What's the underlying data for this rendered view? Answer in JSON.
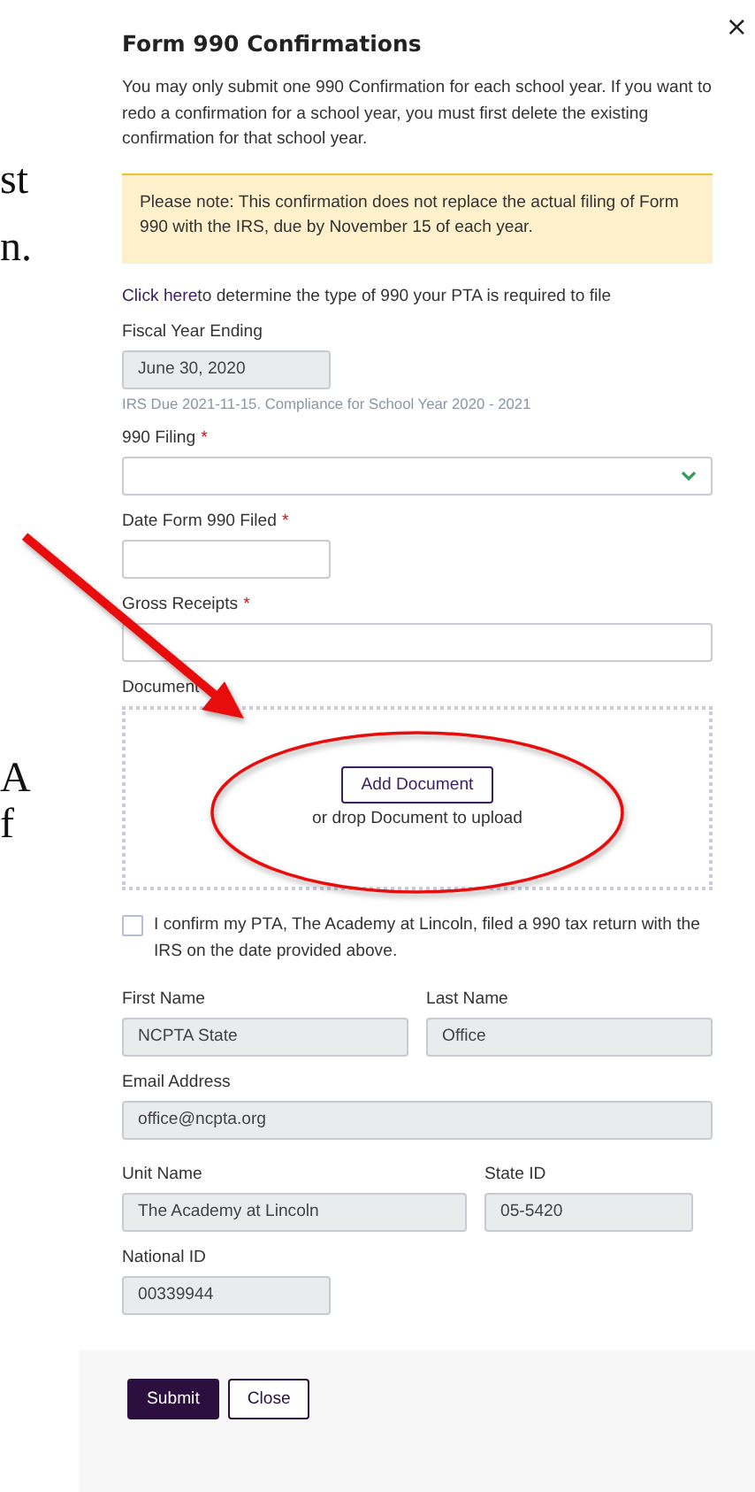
{
  "backdrop_fragments": [
    "st",
    "n.",
    "A",
    "f"
  ],
  "dialog": {
    "title": "Form 990 Confirmations",
    "close": "×"
  },
  "intro": "You may only submit one 990 Confirmation for each school year. If you want to redo a confirmation for a school year, you must first delete the existing confirmation for that school year.",
  "notice": "Please note: This confirmation does not replace the actual filing of Form 990 with the IRS, due by November 15 of each year.",
  "help": {
    "link": "Click here",
    "text": "to determine the type of 990 your PTA is required to file"
  },
  "fiscal_year": {
    "label": "Fiscal Year Ending",
    "value": "June 30, 2020",
    "hint": "IRS Due 2021-11-15. Compliance for School Year 2020 - 2021"
  },
  "filing": {
    "label": "990 Filing",
    "mark": "*"
  },
  "date_filed": {
    "label": "Date Form 990 Filed",
    "mark": "*"
  },
  "gross_receipts": {
    "label": "Gross Receipts",
    "mark": "*"
  },
  "document": {
    "label": "Document",
    "button": "Add Document",
    "drop_text": "or drop Document to upload"
  },
  "confirm": {
    "text": "I confirm my PTA, The Academy at Lincoln, filed a 990 tax return with the IRS on the date provided above.",
    "checked": false
  },
  "first_name": {
    "label": "First Name",
    "value": "NCPTA State"
  },
  "last_name": {
    "label": "Last Name",
    "value": "Office"
  },
  "email": {
    "label": "Email Address",
    "value": "office@ncpta.org"
  },
  "unit_name": {
    "label": "Unit Name",
    "value": "The Academy at Lincoln"
  },
  "state_id": {
    "label": "State ID",
    "value": "05-5420"
  },
  "national_id": {
    "label": "National ID",
    "value": "00339944"
  },
  "buttons": [
    {
      "label": "Submit",
      "kind": "primary"
    },
    {
      "label": "Close",
      "kind": "secondary"
    }
  ]
}
